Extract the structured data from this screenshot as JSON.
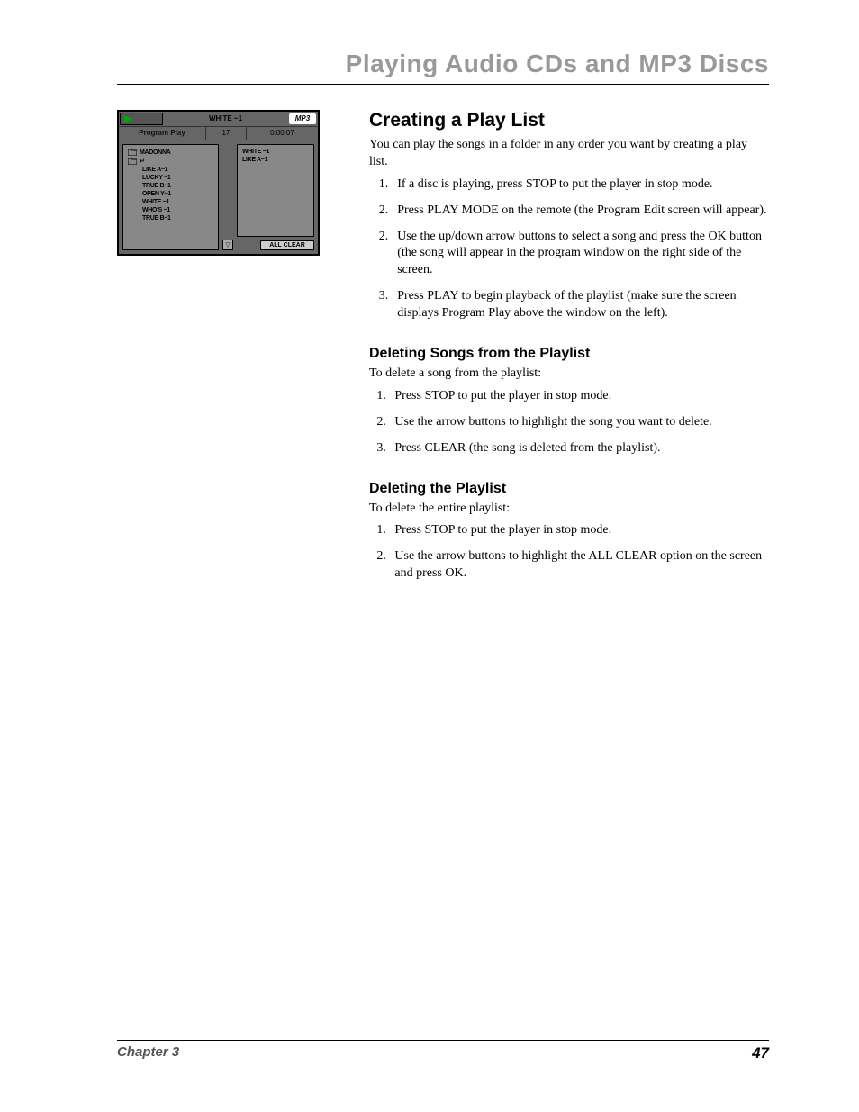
{
  "page_title": "Playing Audio CDs and MP3 Discs",
  "player": {
    "top_label": "WHITE ~1",
    "mp3_badge": "MP3",
    "mode_label": "Program Play",
    "track_num": "17",
    "time": "0:00:07",
    "left_list": [
      "MADONNA",
      "↵",
      "LIKE A~1",
      "LUCKY ~1",
      "TRUE B~1",
      "OPEN Y~1",
      "WHITE ~1",
      "WHO'S ~1",
      "TRUE B~1"
    ],
    "right_list": [
      "WHITE ~1",
      "LIKE A~1"
    ],
    "all_clear": "ALL CLEAR"
  },
  "s1": {
    "heading": "Creating a Play List",
    "intro": "You can play the songs in a folder in any order you want by creating a play list.",
    "steps": [
      "If a disc is playing, press STOP to put the player in stop mode.",
      "Press PLAY MODE on the remote (the Program Edit screen will appear).",
      "Use the up/down arrow buttons to select a song and press the OK button (the song will appear in the program window on the right side of the screen.",
      "Press PLAY to begin playback of the playlist (make sure the screen displays Program Play above the window on the left)."
    ],
    "step_nums": [
      "1.",
      "2.",
      "2.",
      "3."
    ]
  },
  "s2": {
    "heading": "Deleting Songs from the Playlist",
    "intro": "To delete a song from the playlist:",
    "steps": [
      "Press STOP to put the player in stop mode.",
      "Use the arrow buttons to highlight the song you want to delete.",
      "Press CLEAR (the song is deleted from the playlist)."
    ]
  },
  "s3": {
    "heading": "Deleting the Playlist",
    "intro": "To delete the entire playlist:",
    "steps": [
      "Press STOP to put the player in stop mode.",
      "Use the arrow buttons to highlight the ALL CLEAR option on the screen and press OK."
    ]
  },
  "footer": {
    "chapter": "Chapter 3",
    "page": "47"
  }
}
